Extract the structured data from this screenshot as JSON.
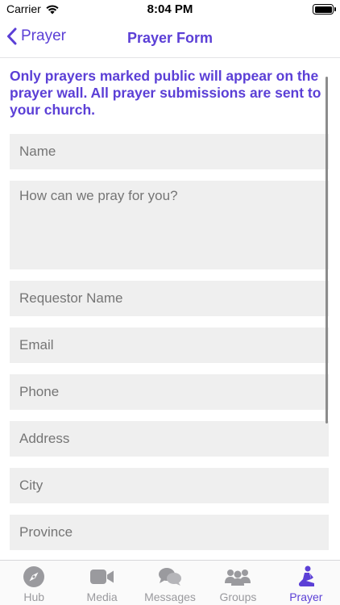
{
  "status_bar": {
    "carrier": "Carrier",
    "time": "8:04 PM"
  },
  "nav": {
    "back_label": "Prayer",
    "title": "Prayer Form"
  },
  "form": {
    "notice": "Only prayers marked public will appear on the prayer wall. All prayer submissions are sent to your church.",
    "fields": [
      {
        "placeholder": "Name",
        "value": ""
      },
      {
        "placeholder": "How can we pray for you?",
        "value": ""
      },
      {
        "placeholder": "Requestor Name",
        "value": ""
      },
      {
        "placeholder": "Email",
        "value": ""
      },
      {
        "placeholder": "Phone",
        "value": ""
      },
      {
        "placeholder": "Address",
        "value": ""
      },
      {
        "placeholder": "City",
        "value": ""
      },
      {
        "placeholder": "Province",
        "value": ""
      }
    ]
  },
  "tabs": [
    {
      "label": "Hub",
      "icon": "compass-icon"
    },
    {
      "label": "Media",
      "icon": "video-camera-icon"
    },
    {
      "label": "Messages",
      "icon": "chat-bubbles-icon"
    },
    {
      "label": "Groups",
      "icon": "people-icon"
    },
    {
      "label": "Prayer",
      "icon": "praying-person-icon",
      "active": true
    }
  ],
  "colors": {
    "accent": "#5b3fd6",
    "field_bg": "#efefef",
    "placeholder": "#b6b6ba",
    "tab_inactive": "#9a9a9e"
  }
}
